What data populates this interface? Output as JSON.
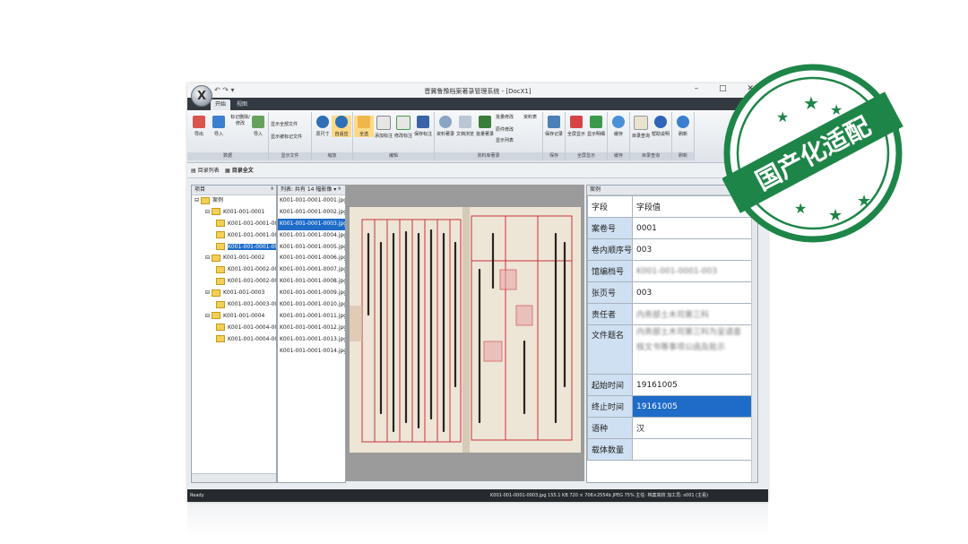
{
  "window": {
    "title": "晋冀鲁豫档案著录管理系统 - [DocX1]",
    "orb_label": "X",
    "qat": "↶ ↷ ▾",
    "controls": "– □ ✕",
    "tabs": [
      "开始",
      "视图"
    ]
  },
  "ribbon": {
    "groups": [
      {
        "label": "数据",
        "buttons": [
          "导出",
          "导入",
          "标记删除/修改",
          "导入"
        ]
      },
      {
        "label": "显示文件",
        "buttons": [
          "显示全部文件",
          "显示被标记文件"
        ]
      },
      {
        "label": "缩放",
        "buttons": [
          "原尺寸",
          "自适应"
        ]
      },
      {
        "label": "编辑",
        "buttons": [
          "全选",
          "添加标注",
          "修改标注",
          "保存标注"
        ]
      },
      {
        "label": "资料库著录",
        "buttons": [
          "资料著录",
          "文档浏览",
          "批量著录",
          "批量修改",
          "资料表",
          "原件修改",
          "显示列表"
        ]
      },
      {
        "label": "保存",
        "buttons": [
          "保存记录"
        ]
      },
      {
        "label": "全屏显示",
        "buttons": [
          "全屏显示",
          "显示明细"
        ]
      },
      {
        "label": "缓存",
        "buttons": [
          "缓存"
        ]
      },
      {
        "label": "目录查询",
        "buttons": [
          "目录查询",
          "帮助说明"
        ]
      },
      {
        "label": "刷新",
        "buttons": [
          "刷新"
        ]
      }
    ]
  },
  "doc_tabs": [
    "目录列表",
    "目录全文"
  ],
  "tree": {
    "header": "项目",
    "pin": "ª",
    "items": [
      {
        "label": "案例",
        "level": 0
      },
      {
        "label": "K001-001-0001",
        "level": 1
      },
      {
        "label": "K001-001-0001-001",
        "level": 2
      },
      {
        "label": "K001-001-0001-002",
        "level": 2
      },
      {
        "label": "K001-001-0001-003",
        "level": 2,
        "selected": true
      },
      {
        "label": "K001-001-0002",
        "level": 1
      },
      {
        "label": "K001-001-0002-001",
        "level": 2
      },
      {
        "label": "K001-001-0002-002",
        "level": 2
      },
      {
        "label": "K001-001-0003",
        "level": 1
      },
      {
        "label": "K001-001-0003-001",
        "level": 2
      },
      {
        "label": "K001-001-0004",
        "level": 1
      },
      {
        "label": "K001-001-0004-001",
        "level": 2
      },
      {
        "label": "K001-001-0004-002",
        "level": 2
      }
    ]
  },
  "files": {
    "header": "列表: 共有 14 幅影像 ▾ ª",
    "items": [
      "K001-001-0001-0001.jpg",
      "K001-001-0001-0002.jpg",
      "K001-001-0001-0003.jpg",
      "K001-001-0001-0004.jpg",
      "K001-001-0001-0005.jpg",
      "K001-001-0001-0006.jpg",
      "K001-001-0001-0007.jpg",
      "K001-001-0001-0008.jpg",
      "K001-001-0001-0009.jpg",
      "K001-001-0001-0010.jpg",
      "K001-001-0001-0011.jpg",
      "K001-001-0001-0012.jpg",
      "K001-001-0001-0013.jpg",
      "K001-001-0001-0014.jpg"
    ],
    "selected_index": 2
  },
  "props": {
    "header": "案例",
    "columns": [
      "字段",
      "字段值"
    ],
    "rows": [
      {
        "k": "案卷号",
        "v": "0001"
      },
      {
        "k": "卷内顺序号",
        "v": "003"
      },
      {
        "k": "馆编档号",
        "v": "K001-001-0001-003",
        "blur": true
      },
      {
        "k": "张页号",
        "v": "003"
      },
      {
        "k": "责任者",
        "v": "内务部土木司第三科",
        "blur": true
      },
      {
        "k": "文件题名",
        "v": "内务部土木司第三科为呈请查核文书等事项公函及批示",
        "blur": true,
        "tall": true
      },
      {
        "k": "起始时间",
        "v": "19161005"
      },
      {
        "k": "终止时间",
        "v": "19161005",
        "selected": true
      },
      {
        "k": "语种",
        "v": "汉"
      },
      {
        "k": "载体数量",
        "v": ""
      }
    ]
  },
  "status": {
    "left": "Ready",
    "right": "K001-001-0001-0003.jpg    155.1 KB    720 × 706×2554b   JPEG    75%    主任: 档案高校    加工员: s001 (主看)"
  },
  "stamp": {
    "text": "国产化适配",
    "color": "#1e8548"
  },
  "colors": {
    "selection": "#1e6cc8",
    "field_bg": "#cfe0f2",
    "status_bg": "#262a2f"
  }
}
